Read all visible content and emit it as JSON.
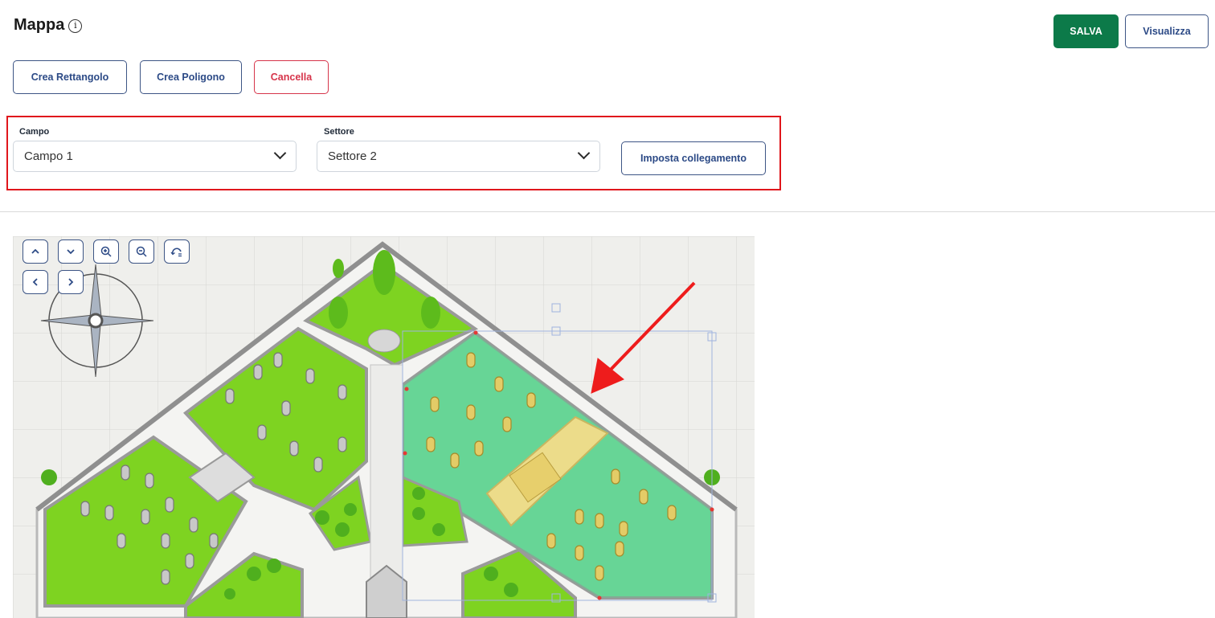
{
  "header": {
    "title": "Mappa",
    "info_icon": "info-circle-icon",
    "save_label": "SALVA",
    "view_label": "Visualizza"
  },
  "toolbar": {
    "create_rectangle": "Crea Rettangolo",
    "create_polygon": "Crea Poligono",
    "delete": "Cancella"
  },
  "link_form": {
    "campo_label": "Campo",
    "campo_value": "Campo 1",
    "settore_label": "Settore",
    "settore_value": "Settore 2",
    "set_link_label": "Imposta collegamento"
  },
  "map_controls": {
    "icons": [
      "chevron-up-icon",
      "chevron-down-icon",
      "zoom-in-icon",
      "zoom-out-icon",
      "reset-view-icon",
      "chevron-left-icon",
      "chevron-right-icon"
    ]
  },
  "colors": {
    "save": "#0c7a49",
    "outline": "#3d5585",
    "danger": "#d6344a",
    "highlight_box": "#e0161c",
    "grass": "#7ed321",
    "selected_area": "#6fdc9c"
  }
}
